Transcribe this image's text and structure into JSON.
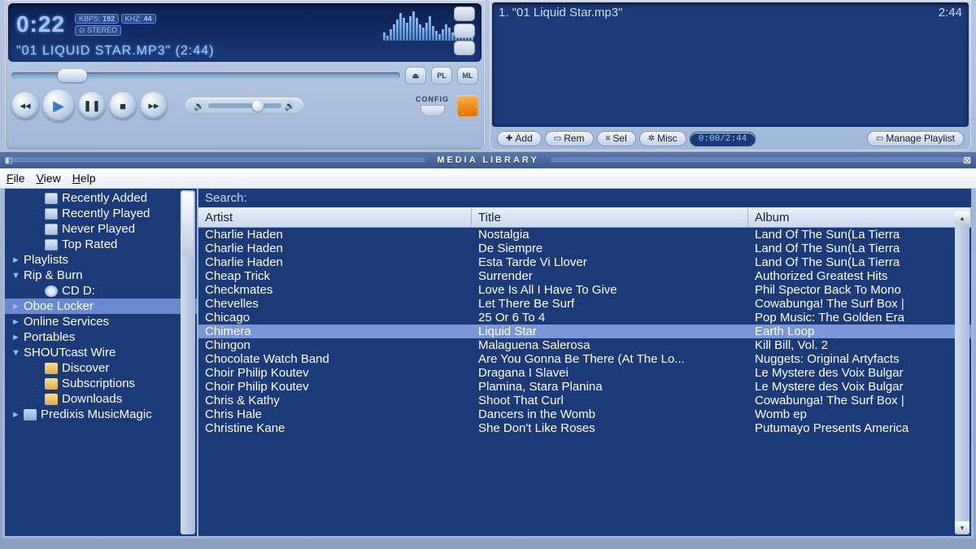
{
  "player": {
    "time": "0:22",
    "kbps_label": "KBPS:",
    "kbps": "192",
    "khz_label": "KHZ:",
    "khz": "44",
    "stereo_pill": "⊙ STEREO",
    "song_display": "\"01 LIQUID STAR.MP3\" (2:44)",
    "pl_btn": "PL",
    "ml_btn": "ML",
    "eject": "⏏",
    "config_label": "CONFIG",
    "vis_heights": [
      10,
      6,
      14,
      20,
      26,
      34,
      28,
      22,
      30,
      36,
      28,
      20,
      16,
      22,
      30,
      18,
      12,
      8,
      14,
      20,
      16,
      10,
      6,
      12,
      18,
      14,
      8,
      4
    ]
  },
  "playlist": {
    "item_text": "1. \"01 Liquid Star.mp3\"",
    "item_dur": "2:44",
    "buttons": {
      "add": "Add",
      "rem": "Rem",
      "sel": "Sel",
      "misc": "Misc",
      "manage": "Manage Playlist"
    },
    "time_display": "0:00/2:44"
  },
  "media_library": {
    "title": "MEDIA LIBRARY",
    "menu": {
      "file": "File",
      "view": "View",
      "help": "Help"
    },
    "search_label": "Search:",
    "columns": {
      "artist": "Artist",
      "title": "Title",
      "album": "Album"
    },
    "tree": [
      {
        "label": "Recently Added",
        "icon": "doc",
        "indent": 1
      },
      {
        "label": "Recently Played",
        "icon": "doc",
        "indent": 1
      },
      {
        "label": "Never Played",
        "icon": "doc",
        "indent": 1
      },
      {
        "label": "Top Rated",
        "icon": "doc",
        "indent": 1
      },
      {
        "label": "Playlists",
        "arrow": "►",
        "indent": 0
      },
      {
        "label": "Rip & Burn",
        "arrow": "▼",
        "indent": 0
      },
      {
        "label": "CD D:",
        "icon": "disc",
        "indent": 2
      },
      {
        "label": "Oboe Locker",
        "arrow": "►",
        "indent": 0,
        "selected": true
      },
      {
        "label": "Online Services",
        "arrow": "►",
        "indent": 0
      },
      {
        "label": "Portables",
        "arrow": "►",
        "indent": 0
      },
      {
        "label": "SHOUTcast Wire",
        "arrow": "▼",
        "indent": 0
      },
      {
        "label": "Discover",
        "icon": "folder",
        "indent": 2
      },
      {
        "label": "Subscriptions",
        "icon": "folder",
        "indent": 2
      },
      {
        "label": "Downloads",
        "icon": "folder",
        "indent": 2
      },
      {
        "label": "Predixis MusicMagic",
        "icon": "box",
        "arrow": "►",
        "indent": 0
      }
    ],
    "tracks": [
      {
        "artist": "Charlie Haden",
        "title": "Nostalgia",
        "album": "Land Of The Sun(La Tierra"
      },
      {
        "artist": "Charlie Haden",
        "title": "De Siempre",
        "album": "Land Of The Sun(La Tierra"
      },
      {
        "artist": "Charlie Haden",
        "title": "Esta Tarde Vi Llover",
        "album": "Land Of The Sun(La Tierra"
      },
      {
        "artist": "Cheap Trick",
        "title": "Surrender",
        "album": "Authorized Greatest Hits"
      },
      {
        "artist": "Checkmates",
        "title": "Love Is All I Have To Give",
        "album": "Phil Spector Back To Mono"
      },
      {
        "artist": "Chevelles",
        "title": "Let There Be Surf",
        "album": "Cowabunga! The Surf Box |"
      },
      {
        "artist": "Chicago",
        "title": "25 Or 6 To 4",
        "album": "Pop Music: The Golden Era"
      },
      {
        "artist": "Chimera",
        "title": "Liquid Star",
        "album": "Earth Loop",
        "selected": true
      },
      {
        "artist": "Chingon",
        "title": "Malaguena Salerosa",
        "album": "Kill Bill, Vol. 2"
      },
      {
        "artist": "Chocolate Watch Band",
        "title": "Are You Gonna Be There (At The Lo...",
        "album": "Nuggets: Original Artyfacts"
      },
      {
        "artist": "Choir Philip Koutev",
        "title": "Dragana I Slavei",
        "album": "Le Mystere des Voix Bulgar"
      },
      {
        "artist": "Choir Philip Koutev",
        "title": "Plamina, Stara Planina",
        "album": "Le Mystere des Voix Bulgar"
      },
      {
        "artist": "Chris & Kathy",
        "title": "Shoot That Curl",
        "album": "Cowabunga! The Surf Box |"
      },
      {
        "artist": "Chris Hale",
        "title": "Dancers in the Womb",
        "album": "Womb ep"
      },
      {
        "artist": "Christine Kane",
        "title": "She Don't Like Roses",
        "album": "Putumayo Presents America"
      }
    ]
  }
}
